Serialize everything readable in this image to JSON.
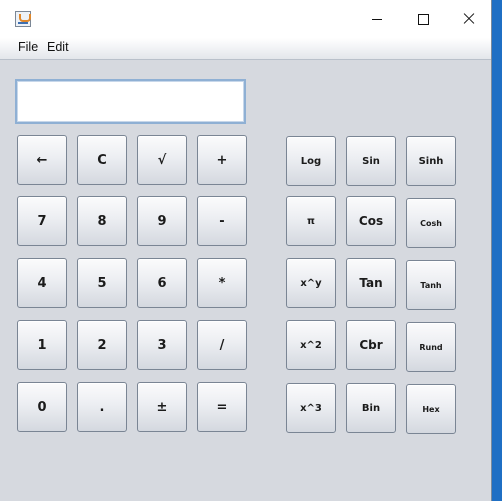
{
  "menubar": {
    "file": "File",
    "edit": "Edit"
  },
  "display": {
    "value": ""
  },
  "keypad": {
    "back": "←",
    "clear": "C",
    "sqrt": "√",
    "plus": "+",
    "seven": "7",
    "eight": "8",
    "nine": "9",
    "minus": "-",
    "four": "4",
    "five": "5",
    "six": "6",
    "times": "*",
    "one": "1",
    "two": "2",
    "three": "3",
    "divide": "/",
    "zero": "0",
    "dot": ".",
    "plusminus": "±",
    "equals": "="
  },
  "scientific": {
    "log": "Log",
    "sin": "Sin",
    "sinh": "Sinh",
    "pi": "π",
    "cos": "Cos",
    "cosh": "Cosh",
    "pow": "x^y",
    "tan": "Tan",
    "tanh": "Tanh",
    "square": "x^2",
    "cbr": "Cbr",
    "rund": "Rund",
    "cube": "x^3",
    "bin": "Bin",
    "hex": "Hex"
  }
}
